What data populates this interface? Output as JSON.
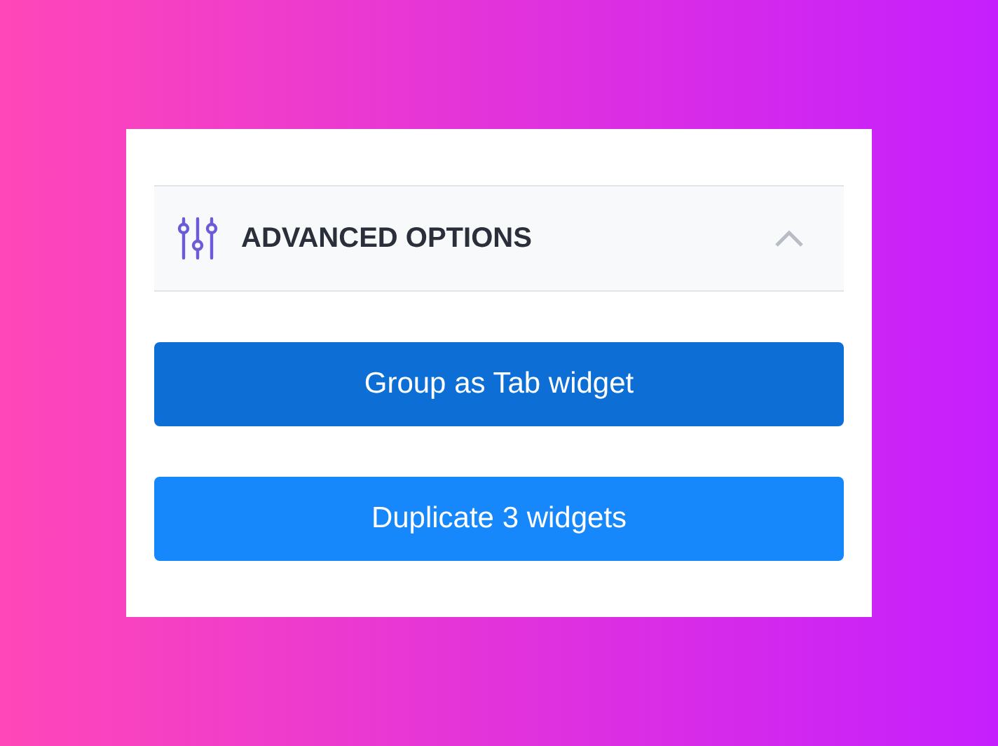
{
  "section": {
    "title": "ADVANCED OPTIONS",
    "expanded": true
  },
  "buttons": [
    {
      "label": "Group as Tab widget",
      "kind": "dark"
    },
    {
      "label": "Duplicate 3 widgets",
      "kind": "light"
    }
  ]
}
